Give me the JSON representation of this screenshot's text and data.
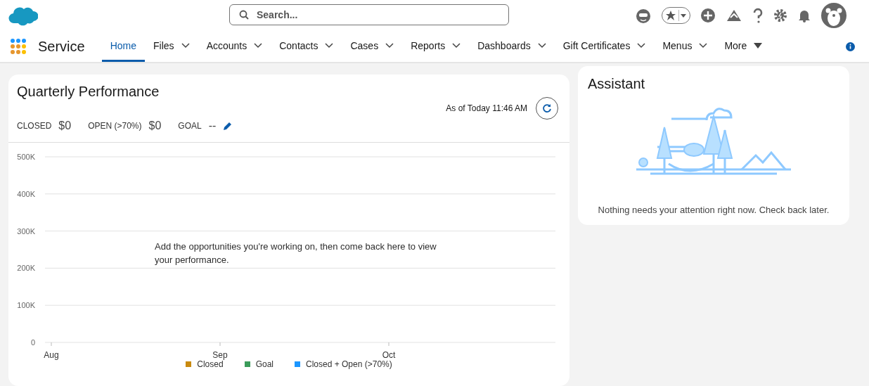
{
  "header": {
    "search": {
      "placeholder": "Search..."
    }
  },
  "nav": {
    "app_name": "Service",
    "items": [
      {
        "label": "Home",
        "selected": true,
        "kind": "plain"
      },
      {
        "label": "Files",
        "selected": false,
        "kind": "chevron"
      },
      {
        "label": "Accounts",
        "selected": false,
        "kind": "chevron"
      },
      {
        "label": "Contacts",
        "selected": false,
        "kind": "chevron"
      },
      {
        "label": "Cases",
        "selected": false,
        "kind": "chevron"
      },
      {
        "label": "Reports",
        "selected": false,
        "kind": "chevron"
      },
      {
        "label": "Dashboards",
        "selected": false,
        "kind": "chevron"
      },
      {
        "label": "Gift Certificates",
        "selected": false,
        "kind": "chevron"
      },
      {
        "label": "Menus",
        "selected": false,
        "kind": "chevron"
      },
      {
        "label": "More",
        "selected": false,
        "kind": "triangle"
      }
    ]
  },
  "performance": {
    "title": "Quarterly Performance",
    "as_of": "As of Today 11:46 AM",
    "metrics": [
      {
        "label": "CLOSED",
        "value": "$0"
      },
      {
        "label": "OPEN (>70%)",
        "value": "$0"
      },
      {
        "label": "GOAL",
        "value": "--",
        "editable": true
      }
    ],
    "empty_message": "Add the opportunities you're working on, then come back here to view your performance.",
    "chart_data": {
      "type": "line",
      "grid": true,
      "categories": [
        "Aug",
        "Sep",
        "Oct"
      ],
      "ylim": [
        0,
        500000
      ],
      "yticks": [
        {
          "value": 0,
          "label": "0"
        },
        {
          "value": 100000,
          "label": "100K"
        },
        {
          "value": 200000,
          "label": "200K"
        },
        {
          "value": 300000,
          "label": "300K"
        },
        {
          "value": 400000,
          "label": "400K"
        },
        {
          "value": 500000,
          "label": "500K"
        }
      ],
      "series": [
        {
          "name": "Closed",
          "color": "#c98a0f",
          "values": [
            null,
            null,
            null
          ]
        },
        {
          "name": "Goal",
          "color": "#3b9c5a",
          "values": [
            null,
            null,
            null
          ]
        },
        {
          "name": "Closed + Open (>70%)",
          "color": "#1b96ff",
          "values": [
            null,
            null,
            null
          ]
        }
      ]
    }
  },
  "assistant": {
    "title": "Assistant",
    "message": "Nothing needs your attention right now. Check back later."
  }
}
